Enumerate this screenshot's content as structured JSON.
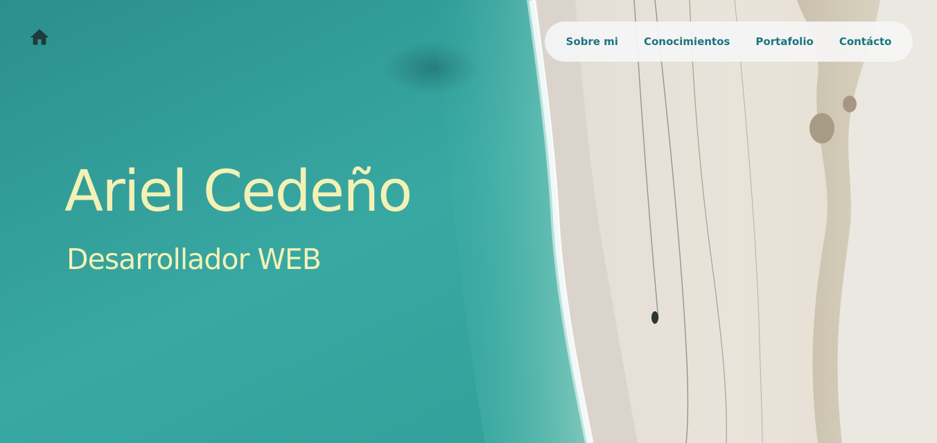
{
  "header": {
    "home_icon": "home-icon",
    "nav": {
      "items": [
        {
          "label": "Sobre mi"
        },
        {
          "label": "Conocimientos"
        },
        {
          "label": "Portafolio"
        },
        {
          "label": "Contácto"
        }
      ]
    }
  },
  "hero": {
    "name": "Ariel Cedeño",
    "role": "Desarrollador WEB"
  },
  "colors": {
    "sea": "#2a9d97",
    "sand": "#e8e1d8",
    "title_text": "#f3f1b5",
    "nav_text": "#1a7580",
    "nav_bg": "#f5f5f5",
    "home_icon": "#1e3a3c"
  }
}
